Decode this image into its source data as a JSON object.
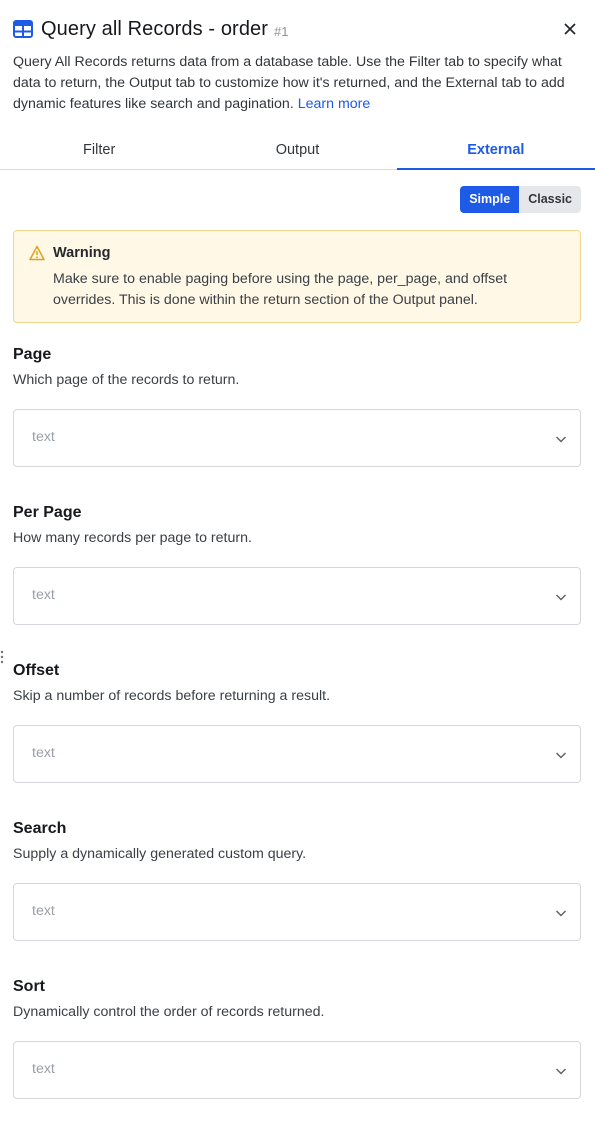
{
  "header": {
    "title": "Query all Records - order",
    "id_label": "#1",
    "table_icon": "table-icon",
    "close_icon": "close-icon"
  },
  "description": {
    "text": "Query All Records returns data from a database table. Use the Filter tab to specify what data to return, the Output tab to customize how it's returned, and the External tab to add dynamic features like search and pagination.",
    "link": "Learn more"
  },
  "tabs": [
    {
      "label": "Filter",
      "active": false
    },
    {
      "label": "Output",
      "active": false
    },
    {
      "label": "External",
      "active": true
    }
  ],
  "mode_toggle": {
    "simple": "Simple",
    "classic": "Classic",
    "selected": "Simple"
  },
  "warning": {
    "icon": "warning-icon",
    "title": "Warning",
    "text": "Make sure to enable paging before using the page, per_page, and offset overrides. This is done within the return section of the Output panel."
  },
  "fields": [
    {
      "label": "Page",
      "description": "Which page of the records to return.",
      "placeholder": "text"
    },
    {
      "label": "Per Page",
      "description": "How many records per page to return.",
      "placeholder": "text"
    },
    {
      "label": "Offset",
      "description": "Skip a number of records before returning a result.",
      "placeholder": "text"
    },
    {
      "label": "Search",
      "description": "Supply a dynamically generated custom query.",
      "placeholder": "text"
    },
    {
      "label": "Sort",
      "description": "Dynamically control the order of records returned.",
      "placeholder": "text"
    }
  ],
  "colors": {
    "accent": "#1d5ae6",
    "warning_bg": "#fff8e6",
    "warning_border": "#f3d58e",
    "warning_icon": "#e0a21b"
  }
}
